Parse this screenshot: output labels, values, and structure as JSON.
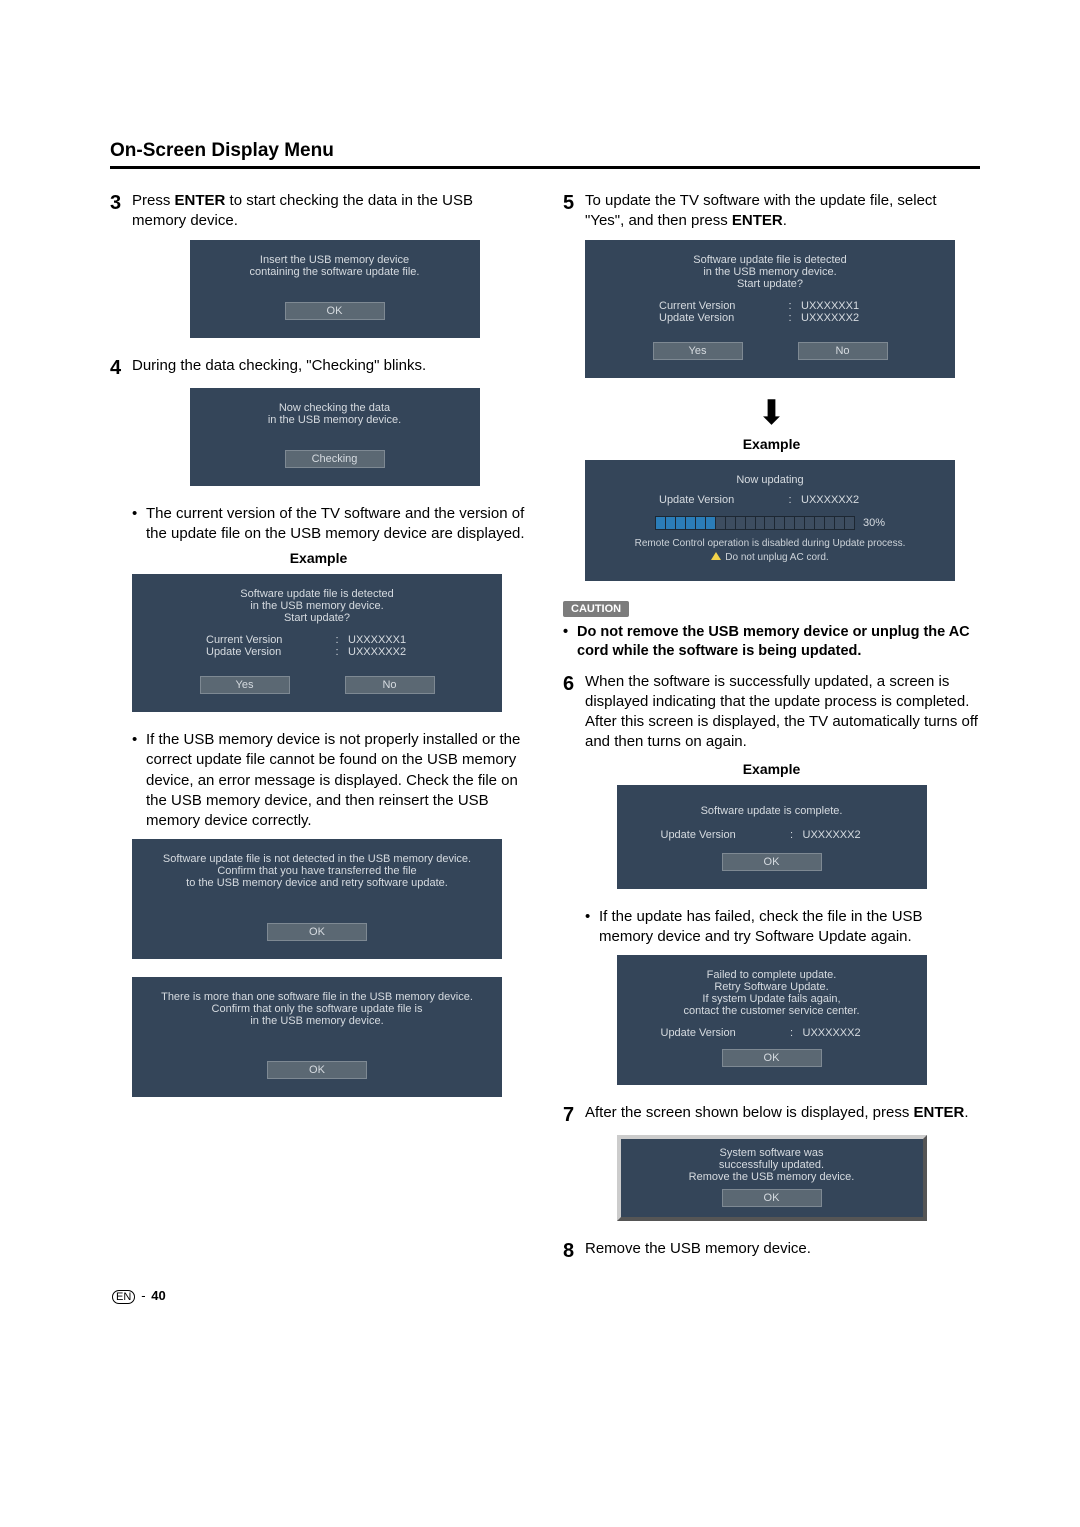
{
  "title": "On-Screen Display Menu",
  "left": {
    "step3": {
      "num": "3",
      "pre": "Press ",
      "bold": "ENTER",
      "post": " to start checking the data in the USB memory device."
    },
    "panelInsert": {
      "l1": "Insert the USB memory device",
      "l2": "containing the software update file.",
      "ok": "OK"
    },
    "step4": {
      "num": "4",
      "text": "During the data checking, \"Checking\" blinks."
    },
    "panelCheck": {
      "l1": "Now checking the data",
      "l2": "in the USB memory device.",
      "btn": "Checking"
    },
    "bullet1": "The current version of the TV software and the version of the update file on the USB memory device are displayed.",
    "exampleLbl": "Example",
    "panelDetected": {
      "l1": "Software update file is detected",
      "l2": "in the USB memory device.",
      "l3": "Start update?",
      "cur_k": "Current Version",
      "cur_v": "UXXXXXX1",
      "upd_k": "Update Version",
      "upd_v": "UXXXXXX2",
      "yes": "Yes",
      "no": "No"
    },
    "bullet2": "If the USB memory device is not properly installed or the correct update file cannot be found on the USB memory device, an error message is displayed. Check the file on the USB memory device, and then reinsert the USB memory device correctly.",
    "panelErr1": {
      "l1": "Software update file is not detected in the USB memory device.",
      "l2": "Confirm that you have transferred the file",
      "l3": "to the USB memory device and retry software update.",
      "ok": "OK"
    },
    "panelErr2": {
      "l1": "There is more than one software file in the USB memory device.",
      "l2": "Confirm that only the software update file is",
      "l3": "in the USB memory device.",
      "ok": "OK"
    }
  },
  "right": {
    "step5": {
      "num": "5",
      "pre": "To update the TV software with the update file, select \"Yes\", and then press ",
      "bold": "ENTER",
      "post": "."
    },
    "panelDetected": {
      "l1": "Software update file is detected",
      "l2": "in the USB memory device.",
      "l3": "Start update?",
      "cur_k": "Current Version",
      "cur_v": "UXXXXXX1",
      "upd_k": "Update Version",
      "upd_v": "UXXXXXX2",
      "yes": "Yes",
      "no": "No"
    },
    "exampleLbl": "Example",
    "panelUpdating": {
      "title": "Now updating",
      "upd_k": "Update Version",
      "upd_v": "UXXXXXX2",
      "pct": "30%",
      "note1": "Remote Control operation is disabled during Update process.",
      "note2": "Do not unplug AC cord."
    },
    "cautionBadge": "CAUTION",
    "cautionText": "Do not remove the USB memory device or unplug the AC cord while the software is being updated.",
    "step6": {
      "num": "6",
      "l1": "When the software is successfully updated, a screen is displayed indicating that the update process is completed.",
      "l2": "After this screen is displayed, the TV automatically turns off and then turns on again."
    },
    "panelComplete": {
      "l1": "Software update is complete.",
      "upd_k": "Update Version",
      "upd_v": "UXXXXXX2",
      "ok": "OK"
    },
    "bulletFail": "If the update has failed, check the file in the USB memory device and try Software Update again.",
    "panelFailed": {
      "l1": "Failed to complete update.",
      "l2": "Retry Software Update.",
      "l3": "If system Update fails again,",
      "l4": "contact the customer service center.",
      "upd_k": "Update Version",
      "upd_v": "UXXXXXX2",
      "ok": "OK"
    },
    "step7": {
      "num": "7",
      "pre": "After the screen shown below is displayed, press ",
      "bold": "ENTER",
      "post": "."
    },
    "panelSuccess": {
      "l1": "System software was",
      "l2": "successfully updated.",
      "l3": "Remove the USB memory device.",
      "ok": "OK"
    },
    "step8": {
      "num": "8",
      "text": "Remove the USB memory device."
    }
  },
  "footer": {
    "en": "EN",
    "page": "40"
  }
}
